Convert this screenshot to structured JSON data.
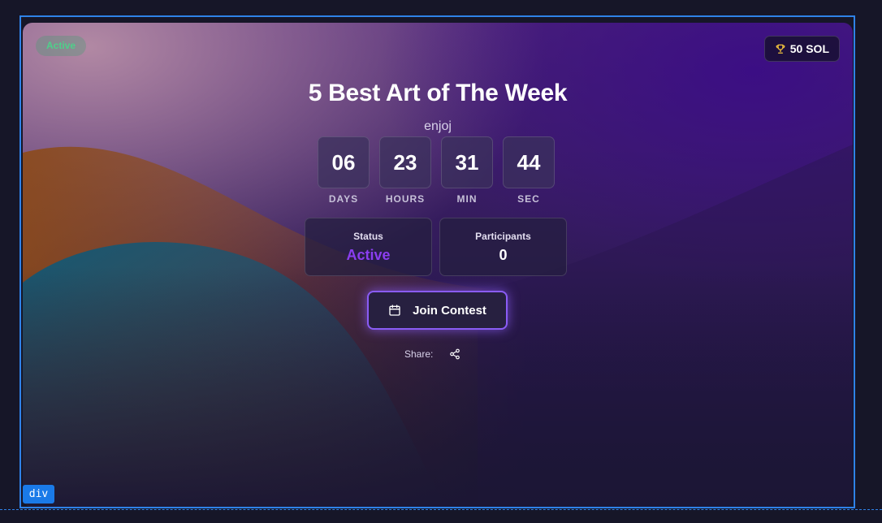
{
  "contest": {
    "status_badge": "Active",
    "prize": "50 SOL",
    "title": "5 Best Art of The Week",
    "subtitle": "enjoj"
  },
  "countdown": [
    {
      "value": "06",
      "label": "DAYS"
    },
    {
      "value": "23",
      "label": "HOURS"
    },
    {
      "value": "31",
      "label": "MIN"
    },
    {
      "value": "44",
      "label": "SEC"
    }
  ],
  "stats": {
    "status": {
      "label": "Status",
      "value": "Active"
    },
    "participants": {
      "label": "Participants",
      "value": "0"
    }
  },
  "actions": {
    "join_label": "Join Contest",
    "share_label": "Share:"
  },
  "inspector": {
    "tag_label": "div"
  },
  "icons": {
    "prize": "trophy-icon",
    "join": "calendar-icon",
    "share": "share-icon"
  },
  "colors": {
    "accent": "#8a5cf5",
    "status_active": "#8b3ef0",
    "badge_active": "#4ed08a",
    "trophy": "#f3c43c",
    "outline": "#2f82e8"
  }
}
